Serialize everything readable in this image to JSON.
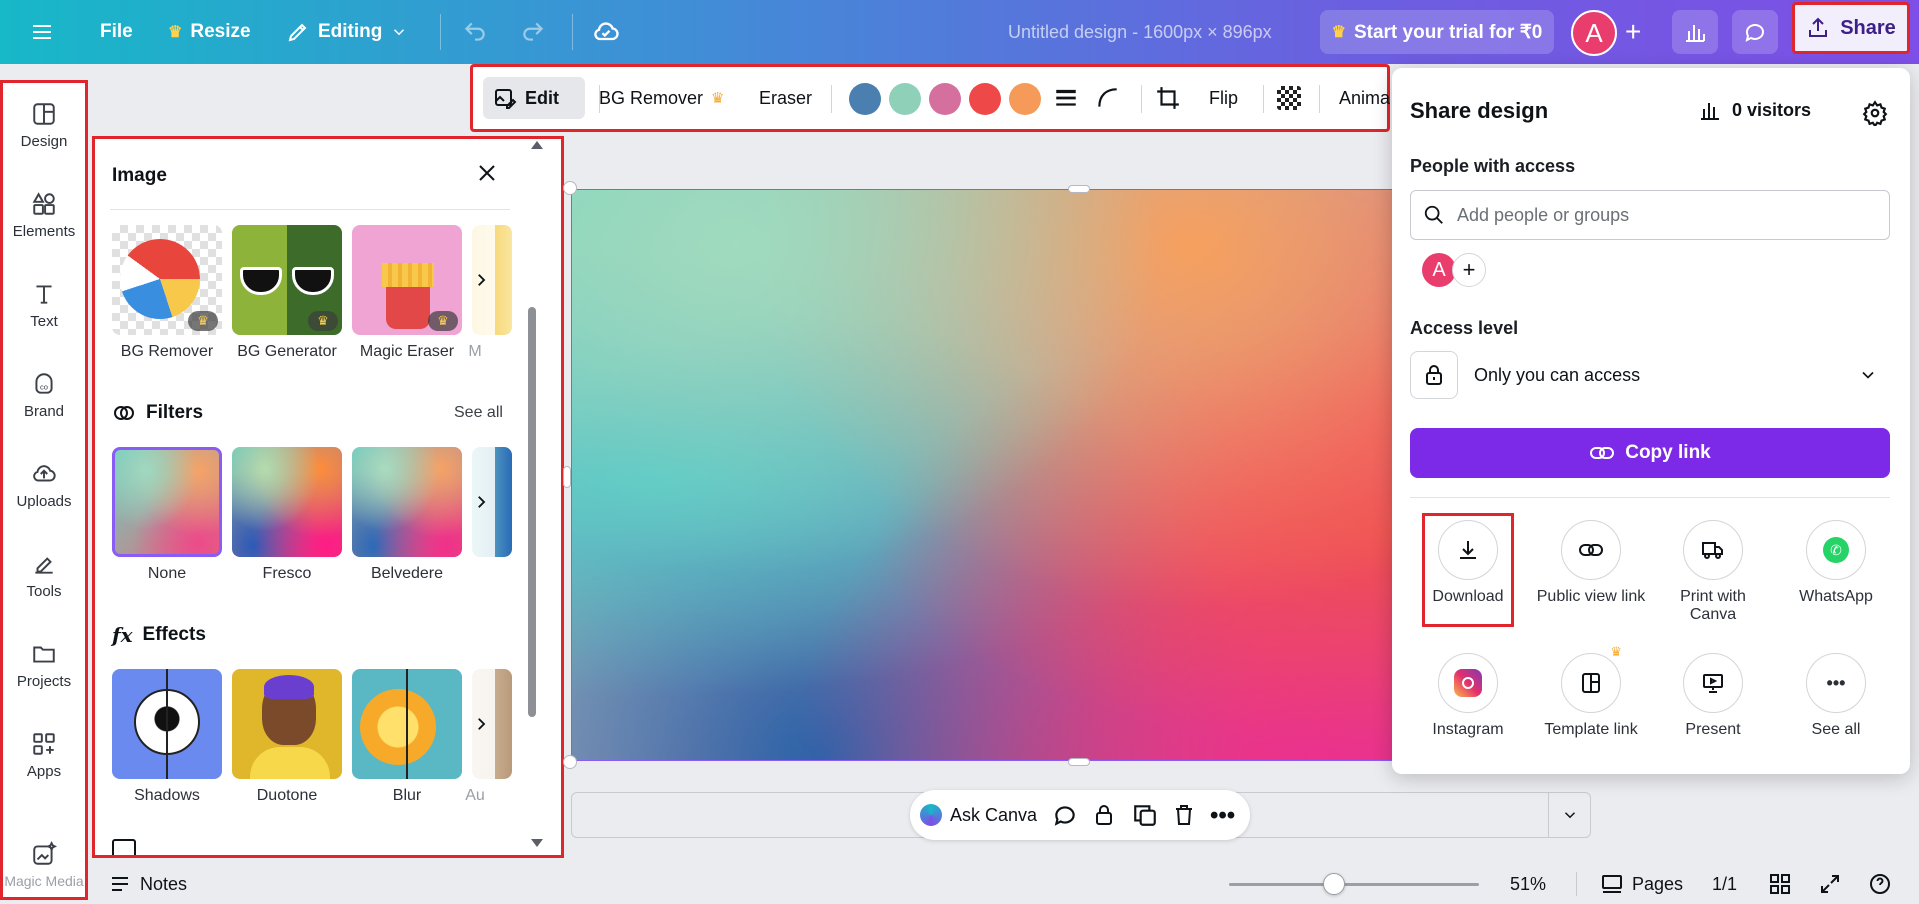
{
  "topbar": {
    "file": "File",
    "resize": "Resize",
    "editing": "Editing",
    "title": "Untitled design - 1600px × 896px",
    "trial": "Start your trial for ₹0",
    "avatar_letter": "A",
    "share": "Share"
  },
  "sidebar": {
    "items": [
      {
        "label": "Design"
      },
      {
        "label": "Elements"
      },
      {
        "label": "Text"
      },
      {
        "label": "Brand"
      },
      {
        "label": "Uploads"
      },
      {
        "label": "Tools"
      },
      {
        "label": "Projects"
      },
      {
        "label": "Apps"
      },
      {
        "label": "Magic Media"
      }
    ]
  },
  "panel": {
    "title": "Image",
    "image_tools": [
      "BG Remover",
      "BG Generator",
      "Magic Eraser",
      "M"
    ],
    "filters_title": "Filters",
    "filters_see_all": "See all",
    "filters": [
      "None",
      "Fresco",
      "Belvedere"
    ],
    "effects_title": "Effects",
    "effects": [
      "Shadows",
      "Duotone",
      "Blur",
      "Au"
    ]
  },
  "toolbar": {
    "edit": "Edit",
    "bg_remover": "BG Remover",
    "eraser": "Eraser",
    "colors": [
      "#4a7fb0",
      "#8fd0b8",
      "#d46f9e",
      "#ef4848",
      "#f59a58"
    ],
    "flip": "Flip",
    "animate": "Anima"
  },
  "bottom": {
    "notes": "Notes",
    "ask_canva": "Ask Canva",
    "zoom": "51%",
    "pages": "Pages",
    "page_count": "1/1"
  },
  "share_panel": {
    "title": "Share design",
    "visitors": "0 visitors",
    "people_label": "People with access",
    "search_placeholder": "Add people or groups",
    "avatar_letter": "A",
    "access_label": "Access level",
    "access_value": "Only you can access",
    "copy_link": "Copy link",
    "options": [
      {
        "label": "Download"
      },
      {
        "label": "Public view link"
      },
      {
        "label": "Print with Canva"
      },
      {
        "label": "WhatsApp"
      },
      {
        "label": "Instagram"
      },
      {
        "label": "Template link"
      },
      {
        "label": "Present"
      },
      {
        "label": "See all"
      }
    ]
  }
}
